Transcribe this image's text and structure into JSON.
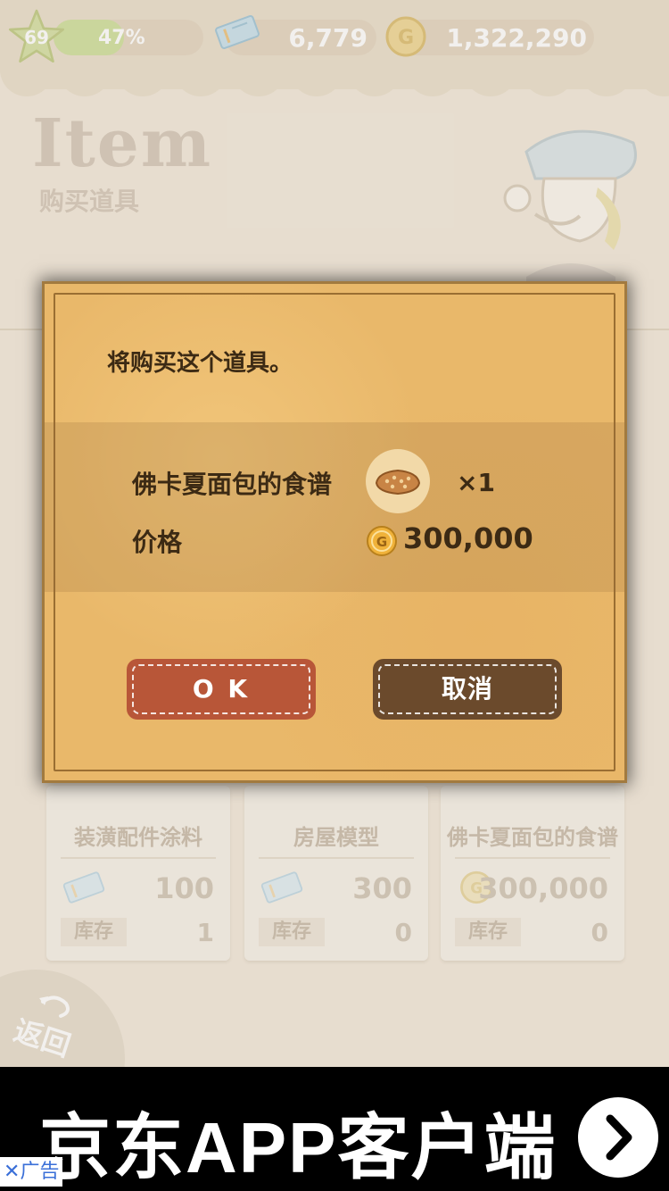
{
  "hud": {
    "level": "69",
    "xp_percent_label": "47%",
    "xp_fraction": 0.47,
    "tickets": "6,779",
    "coins": "1,322,290"
  },
  "header": {
    "title": "Item",
    "subtitle": "购买道具"
  },
  "cards": [
    {
      "name": "装潢配件涂料",
      "currency_icon": "ticket-icon",
      "price": "100",
      "stock_label": "库存",
      "stock": "1"
    },
    {
      "name": "房屋模型",
      "currency_icon": "ticket-icon",
      "price": "300",
      "stock_label": "库存",
      "stock": "0"
    },
    {
      "name": "佛卡夏面包的食谱",
      "currency_icon": "coin-icon",
      "price": "300,000",
      "stock_label": "库存",
      "stock": "0"
    }
  ],
  "back": {
    "label": "返回"
  },
  "dialog": {
    "message": "将购买这个道具。",
    "item_name": "佛卡夏面包的食谱",
    "quantity": "×1",
    "price_label": "价格",
    "price": "300,000",
    "ok_label": "O K",
    "cancel_label": "取消"
  },
  "ad": {
    "text": "京东APP客户端",
    "label": "广告"
  },
  "colors": {
    "ok_button": "#b85638",
    "cancel_button": "#6b4a2c",
    "modal_paper": "#e9b86a",
    "ad_background": "#000000"
  }
}
